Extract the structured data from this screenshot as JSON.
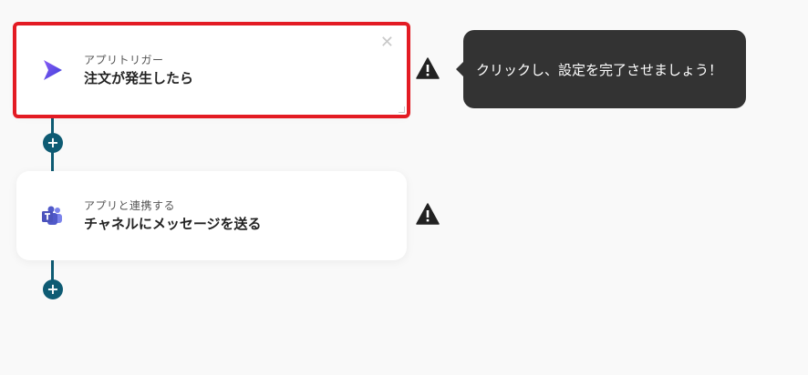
{
  "steps": [
    {
      "sub": "アプリトリガー",
      "title": "注文が発生したら",
      "icon": "play-trigger-icon",
      "accent": "#6b4fd8",
      "selected": true
    },
    {
      "sub": "アプリと連携する",
      "title": "チャネルにメッセージを送る",
      "icon": "teams-icon",
      "accent": "#5059c9",
      "selected": false
    }
  ],
  "close_glyph": "✕",
  "add_glyph": "+",
  "tooltip": {
    "text": "クリックし、設定を完了させましょう！"
  },
  "colors": {
    "flow": "#0e5b73",
    "highlight": "#e31b23",
    "tooltip_bg": "#333333"
  }
}
